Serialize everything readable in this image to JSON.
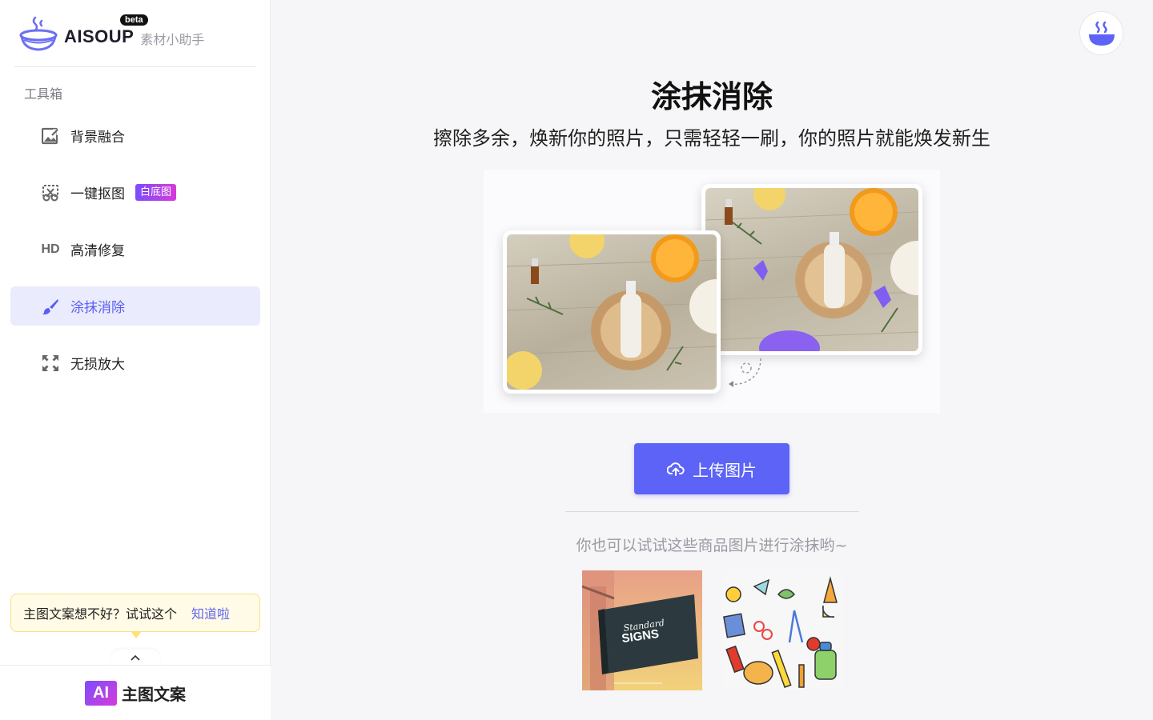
{
  "sidebar": {
    "logo_text": "AISOUP",
    "logo_beta": "beta",
    "logo_subtitle": "素材小助手",
    "section_title": "工具箱",
    "items": [
      {
        "label": "背景融合",
        "icon": "image-edit-icon"
      },
      {
        "label": "一键抠图",
        "icon": "cutout-icon",
        "badge": "白底图"
      },
      {
        "label": "高清修复",
        "icon": "hd-icon",
        "icon_text": "HD"
      },
      {
        "label": "涂抹消除",
        "icon": "brush-icon",
        "active": true
      },
      {
        "label": "无损放大",
        "icon": "expand-icon"
      }
    ],
    "tip": {
      "text": "主图文案想不好？试试这个",
      "link": "知道啦"
    },
    "bottom": {
      "badge": "AI",
      "label": "主图文案"
    }
  },
  "main": {
    "title": "涂抹消除",
    "subtitle": "擦除多余，焕新你的照片，只需轻轻一刷，你的照片就能焕发新生",
    "upload_label": "上传图片",
    "try_text": "你也可以试试这些商品图片进行涂抹哟~",
    "sample_sign_text": "SIGNS",
    "sample_sign_script": "Standard"
  },
  "colors": {
    "accent": "#5c63f6",
    "active_bg": "#eaebfc",
    "badge_gradient_start": "#7b4dff",
    "badge_gradient_end": "#d63bd9",
    "tip_bg": "#fffbe6"
  }
}
